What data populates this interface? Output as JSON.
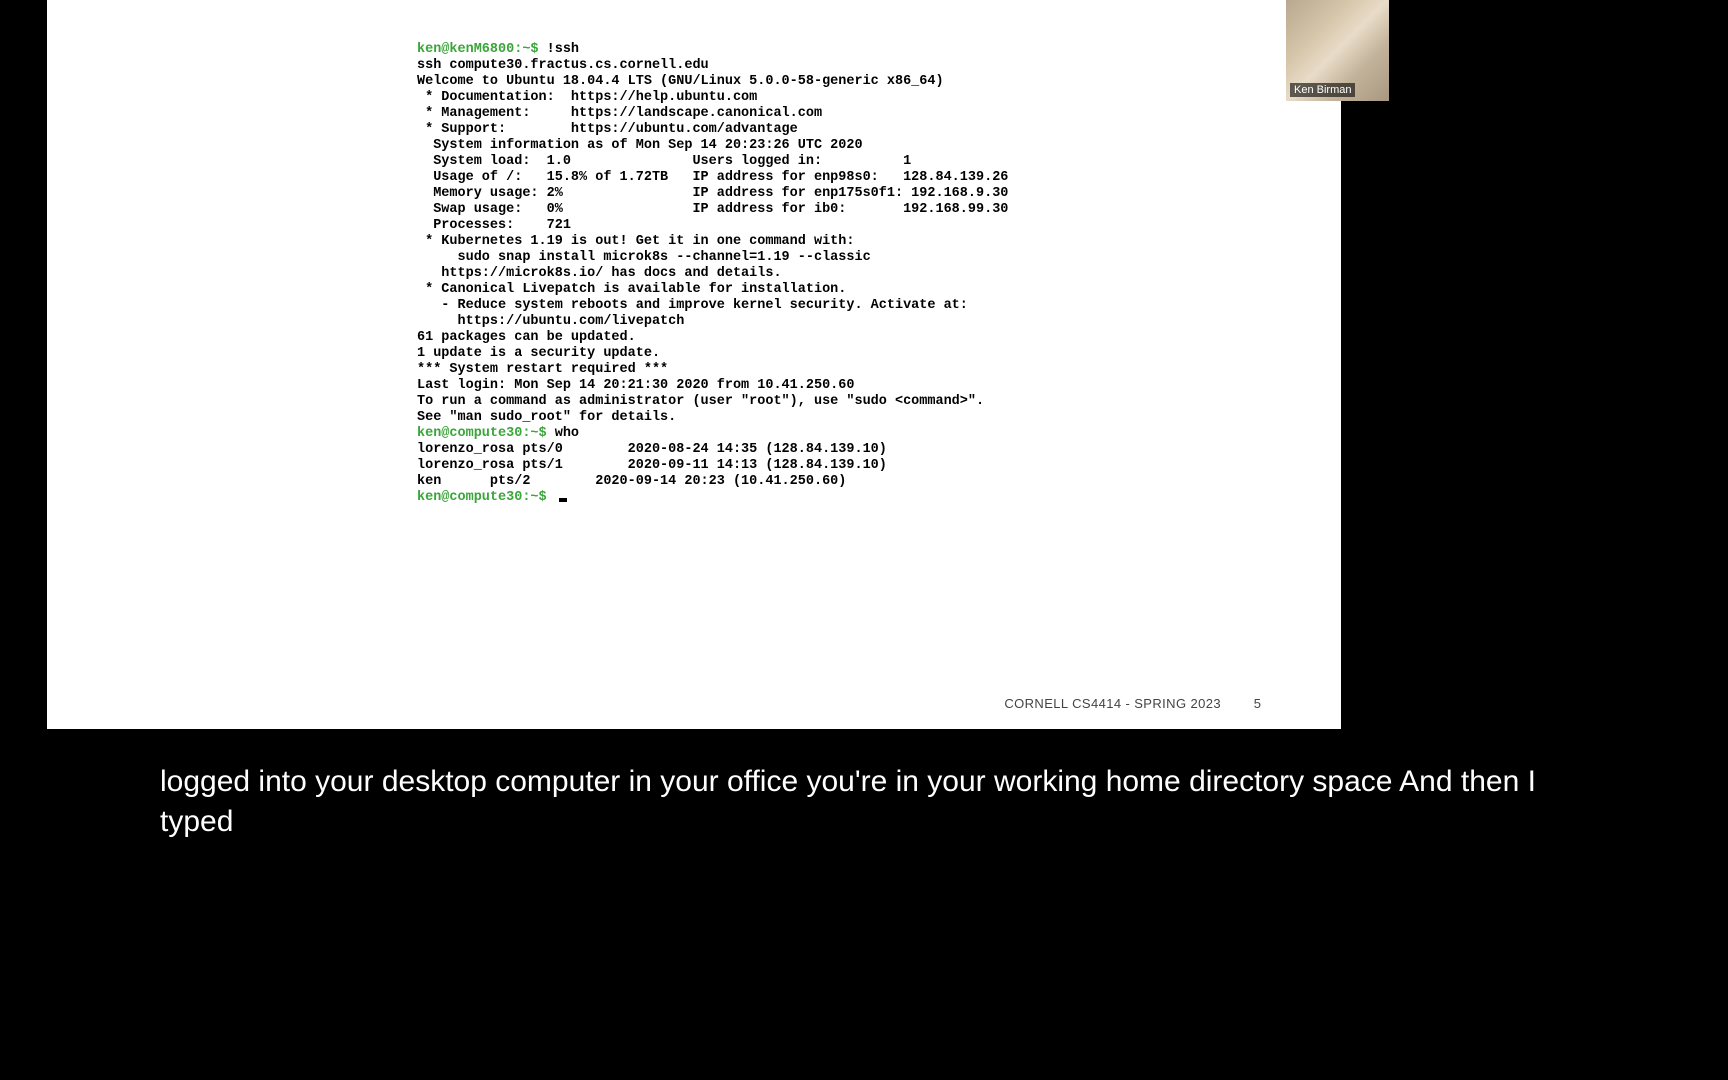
{
  "terminal": {
    "lines": [
      {
        "prompt": "ken@kenM6800:~$ ",
        "cmd": "!ssh"
      },
      {
        "text": "ssh compute30.fractus.cs.cornell.edu"
      },
      {
        "text": "Welcome to Ubuntu 18.04.4 LTS (GNU/Linux 5.0.0-58-generic x86_64)"
      },
      {
        "text": ""
      },
      {
        "text": " * Documentation:  https://help.ubuntu.com"
      },
      {
        "text": " * Management:     https://landscape.canonical.com"
      },
      {
        "text": " * Support:        https://ubuntu.com/advantage"
      },
      {
        "text": ""
      },
      {
        "text": "  System information as of Mon Sep 14 20:23:26 UTC 2020"
      },
      {
        "text": ""
      },
      {
        "text": "  System load:  1.0               Users logged in:          1"
      },
      {
        "text": "  Usage of /:   15.8% of 1.72TB   IP address for enp98s0:   128.84.139.26"
      },
      {
        "text": "  Memory usage: 2%                IP address for enp175s0f1: 192.168.9.30"
      },
      {
        "text": "  Swap usage:   0%                IP address for ib0:       192.168.99.30"
      },
      {
        "text": "  Processes:    721"
      },
      {
        "text": ""
      },
      {
        "text": " * Kubernetes 1.19 is out! Get it in one command with:"
      },
      {
        "text": ""
      },
      {
        "text": "     sudo snap install microk8s --channel=1.19 --classic"
      },
      {
        "text": ""
      },
      {
        "text": "   https://microk8s.io/ has docs and details."
      },
      {
        "text": ""
      },
      {
        "text": " * Canonical Livepatch is available for installation."
      },
      {
        "text": "   - Reduce system reboots and improve kernel security. Activate at:"
      },
      {
        "text": "     https://ubuntu.com/livepatch"
      },
      {
        "text": ""
      },
      {
        "text": "61 packages can be updated."
      },
      {
        "text": "1 update is a security update."
      },
      {
        "text": ""
      },
      {
        "text": ""
      },
      {
        "text": "*** System restart required ***"
      },
      {
        "text": "Last login: Mon Sep 14 20:21:30 2020 from 10.41.250.60"
      },
      {
        "text": "To run a command as administrator (user \"root\"), use \"sudo <command>\"."
      },
      {
        "text": "See \"man sudo_root\" for details."
      },
      {
        "text": ""
      },
      {
        "prompt": "ken@compute30:~$ ",
        "cmd": "who"
      },
      {
        "text": "lorenzo_rosa pts/0        2020-08-24 14:35 (128.84.139.10)"
      },
      {
        "text": "lorenzo_rosa pts/1        2020-09-11 14:13 (128.84.139.10)"
      },
      {
        "text": "ken      pts/2        2020-09-14 20:23 (10.41.250.60)"
      },
      {
        "prompt": "ken@compute30:~$ ",
        "cmd": "",
        "cursor": true
      }
    ]
  },
  "footer": {
    "course": "CORNELL CS4414 - SPRING 2023",
    "page": "5"
  },
  "webcam": {
    "name": "Ken Birman"
  },
  "caption": {
    "text": "logged into your desktop computer in your office you're in your working home directory space And then I typed"
  }
}
